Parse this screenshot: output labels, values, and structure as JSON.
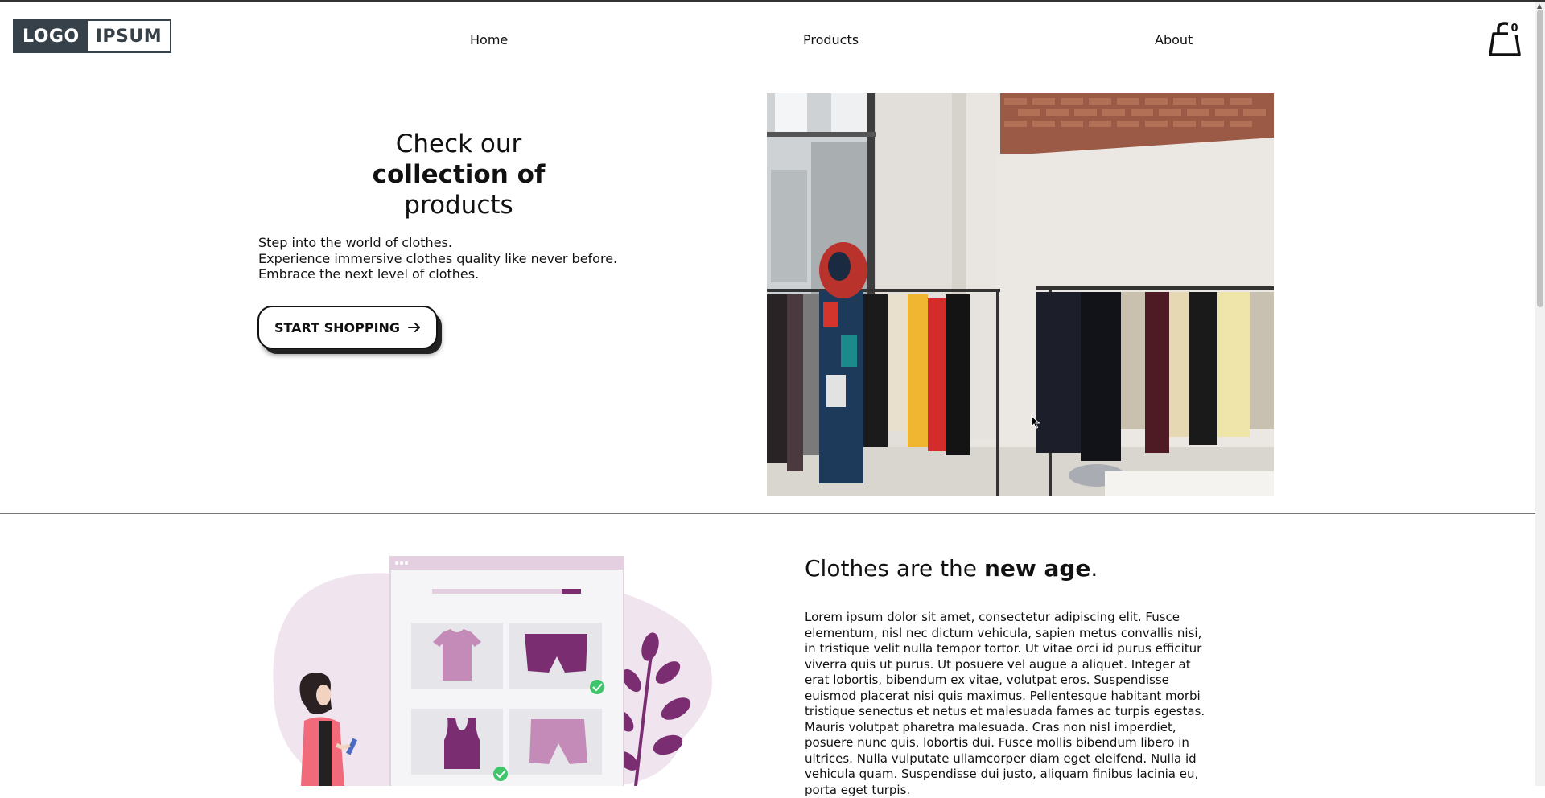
{
  "header": {
    "logo_left": "LOGO",
    "logo_right": "IPSUM",
    "nav": [
      {
        "label": "Home"
      },
      {
        "label": "Products"
      },
      {
        "label": "About"
      }
    ],
    "cart_count": "0"
  },
  "hero": {
    "title_line1": "Check our",
    "title_line2": "collection of",
    "title_line3": "products",
    "subtitle_line1": "Step into the world of clothes.",
    "subtitle_line2": "Experience immersive clothes quality like never before. Embrace the next level of clothes.",
    "cta_label": "START SHOPPING"
  },
  "section2": {
    "title_prefix": "Clothes are the ",
    "title_bold": "new age",
    "title_suffix": ".",
    "body": "Lorem ipsum dolor sit amet, consectetur adipiscing elit. Fusce elementum, nisl nec dictum vehicula, sapien metus convallis nisi, in tristique velit nulla tempor tortor. Ut vitae orci id purus efficitur viverra quis ut purus. Ut posuere vel augue a aliquet. Integer at erat lobortis, bibendum ex vitae, volutpat eros. Suspendisse euismod placerat nisi quis maximus. Pellentesque habitant morbi tristique senectus et netus et malesuada fames ac turpis egestas. Mauris volutpat pharetra malesuada. Cras non nisl imperdiet, posuere nunc quis, lobortis dui. Fusce mollis bibendum libero in ultrices. Nulla vulputate ullamcorper diam eget eleifend. Nulla id vehicula quam. Suspendisse dui justo, aliquam finibus lacinia eu, porta eget turpis."
  },
  "icons": {
    "cart": "shopping-bag-icon",
    "cta_arrow": "arrow-right-icon",
    "check": "check-circle-icon"
  },
  "colors": {
    "logo_dark": "#374149",
    "accent_purple": "#7b2d72",
    "light_purple": "#c48bb9",
    "blob_pink": "#f0e4ee",
    "check_green": "#3fc56b"
  }
}
